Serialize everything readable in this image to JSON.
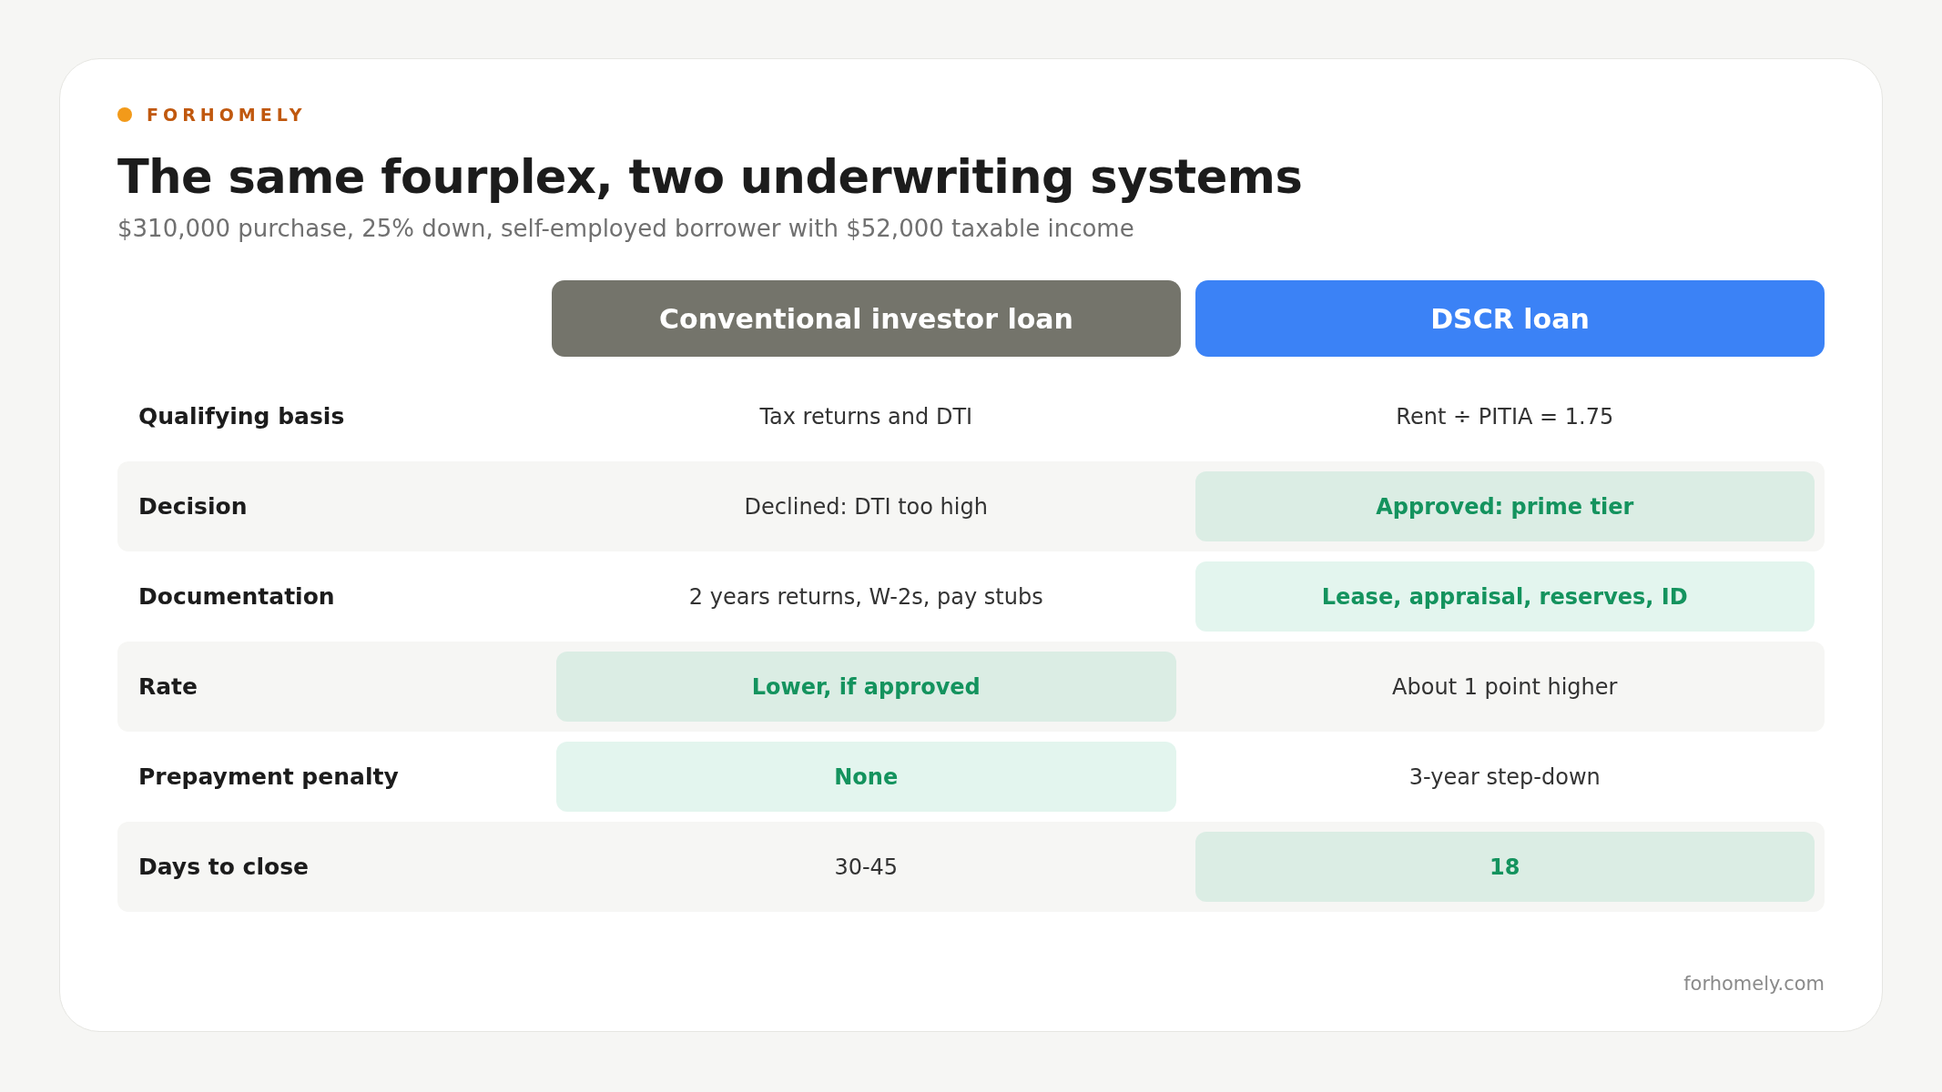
{
  "brand": "FORHOMELY",
  "title": "The same fourplex, two underwriting systems",
  "subtitle": "$310,000 purchase, 25% down, self-employed borrower with $52,000 taxable income",
  "columns": [
    {
      "label": "Conventional investor loan",
      "color": "#74746b"
    },
    {
      "label": "DSCR loan",
      "color": "#3b82f6"
    }
  ],
  "rows": [
    {
      "label": "Qualifying basis",
      "cells": [
        {
          "text": "Tax returns and DTI",
          "highlighted": false
        },
        {
          "text": "Rent ÷ PITIA = 1.75",
          "highlighted": false
        }
      ]
    },
    {
      "label": "Decision",
      "cells": [
        {
          "text": "Declined: DTI too high",
          "highlighted": false
        },
        {
          "text": "Approved: prime tier",
          "highlighted": true
        }
      ]
    },
    {
      "label": "Documentation",
      "cells": [
        {
          "text": "2 years returns, W-2s, pay stubs",
          "highlighted": false
        },
        {
          "text": "Lease, appraisal, reserves, ID",
          "highlighted": true
        }
      ]
    },
    {
      "label": "Rate",
      "cells": [
        {
          "text": "Lower, if approved",
          "highlighted": true
        },
        {
          "text": "About 1 point higher",
          "highlighted": false
        }
      ]
    },
    {
      "label": "Prepayment penalty",
      "cells": [
        {
          "text": "None",
          "highlighted": true
        },
        {
          "text": "3-year step-down",
          "highlighted": false
        }
      ]
    },
    {
      "label": "Days to close",
      "cells": [
        {
          "text": "30-45",
          "highlighted": false
        },
        {
          "text": "18",
          "highlighted": true
        }
      ]
    }
  ],
  "footer": "forhomely.com"
}
